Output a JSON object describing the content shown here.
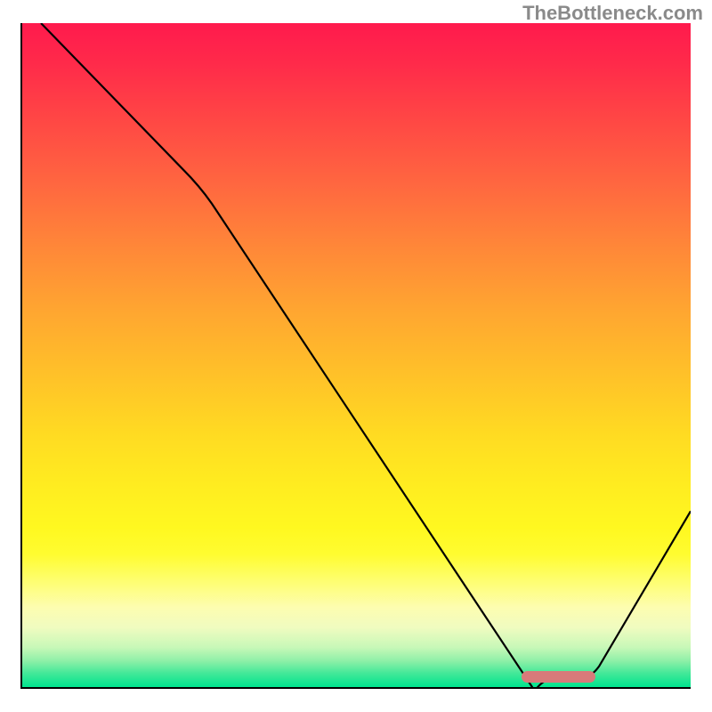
{
  "watermark": "TheBottleneck.com",
  "chart_data": {
    "type": "line",
    "title": "",
    "xlabel": "",
    "ylabel": "",
    "xlim": [
      0,
      1
    ],
    "ylim": [
      0,
      1
    ],
    "curve_points": [
      {
        "x": 0.028,
        "y": 1.0
      },
      {
        "x": 0.265,
        "y": 0.755
      },
      {
        "x": 0.78,
        "y": 0.013
      },
      {
        "x": 0.85,
        "y": 0.013
      },
      {
        "x": 1.0,
        "y": 0.265
      }
    ],
    "optimal_marker": {
      "x_start": 0.745,
      "x_end": 0.855,
      "y": 0.019
    },
    "gradient_colors": {
      "top": "#ff1a4d",
      "mid": "#ffdb22",
      "bottom": "#00e48e"
    }
  }
}
